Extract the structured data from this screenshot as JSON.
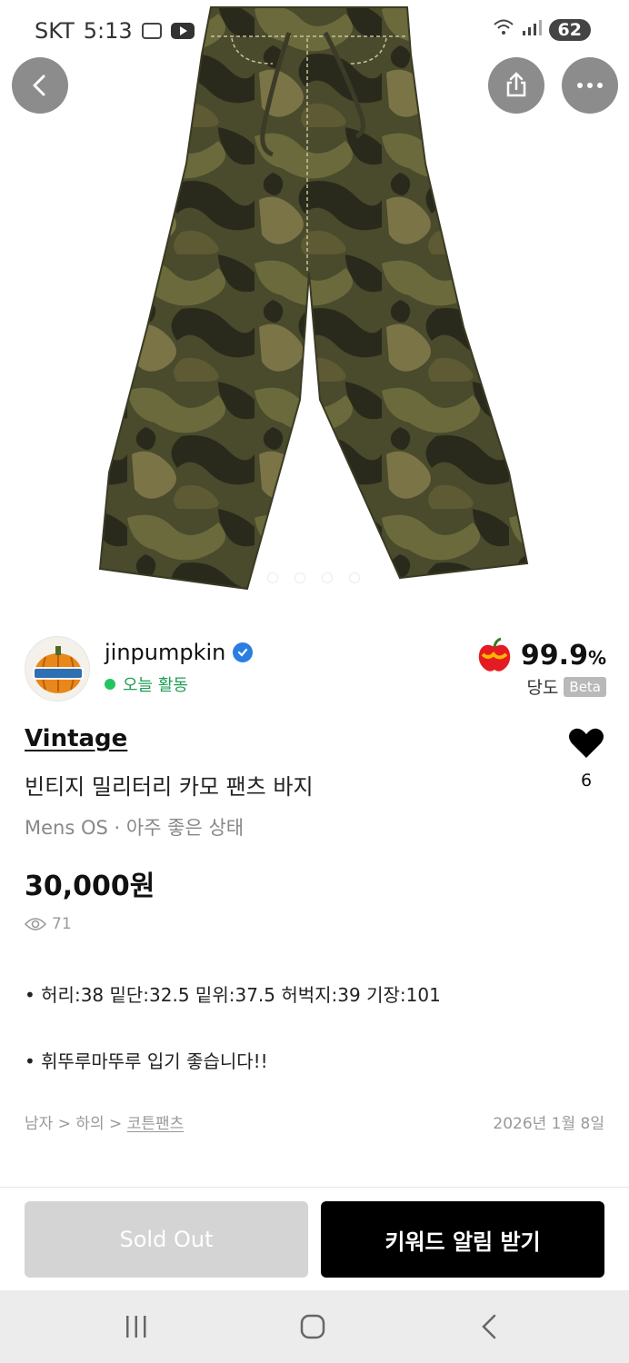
{
  "status_bar": {
    "carrier": "SKT",
    "time": "5:13",
    "battery": "62"
  },
  "icons": {
    "back": "chevron-left-icon",
    "share": "share-icon",
    "more": "more-dots-icon",
    "like": "heart-icon",
    "views": "eye-icon",
    "verified": "verified-badge-icon",
    "rating": "apple-icon"
  },
  "image_carousel": {
    "count": 4,
    "active_index": 0
  },
  "seller": {
    "name": "jinpumpkin",
    "activity": "오늘 활동",
    "rating_value": "99.9",
    "rating_unit": "%",
    "rating_label": "당도",
    "rating_badge": "Beta"
  },
  "product": {
    "brand": "Vintage",
    "title": "빈티지 밀리터리 카모 팬츠 바지",
    "meta": "Mens OS · 아주 좋은 상태",
    "price": "30,000원",
    "views": "71",
    "likes": "6",
    "description": [
      "• 허리:38 밑단:32.5 밑위:37.5 허벅지:39 기장:101",
      "• 휘뚜루마뚜루 입기 좋습니다!!"
    ],
    "breadcrumb": {
      "level1": "남자",
      "level2": "하의",
      "level3": "코튼팬츠",
      "separator": ">"
    },
    "date": "2026년 1월 8일"
  },
  "actions": {
    "sold_out_label": "Sold Out",
    "keyword_alert_label": "키워드 알림 받기"
  },
  "colors": {
    "accent_green": "#22c55e",
    "verified_blue": "#2a7de1",
    "primary_button": "#000000",
    "disabled_button": "#d4d4d4"
  }
}
